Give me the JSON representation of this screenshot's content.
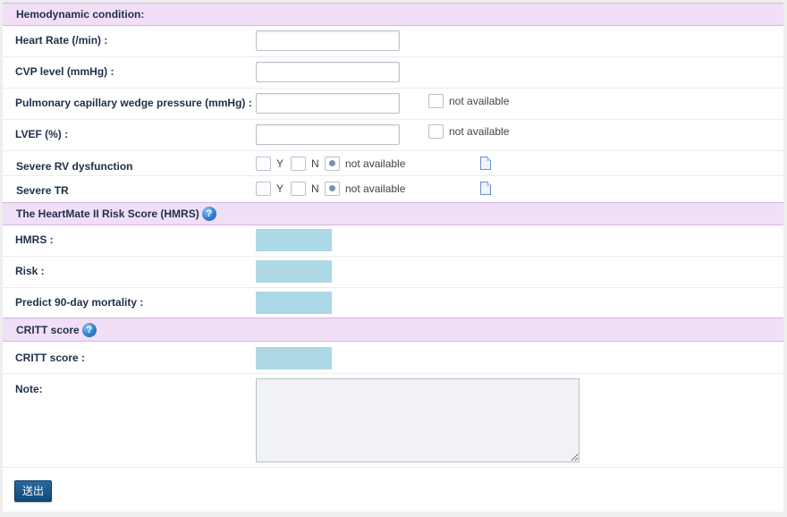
{
  "sections": {
    "hemodynamic": "Hemodynamic condition:",
    "hmrs": "The HeartMate II Risk Score (HMRS)",
    "critt": "CRITT score"
  },
  "help_glyph": "?",
  "fields": {
    "heart_rate": {
      "label": "Heart Rate (/min) :",
      "value": ""
    },
    "cvp": {
      "label": "CVP level (mmHg) :",
      "value": ""
    },
    "pcwp": {
      "label": "Pulmonary capillary wedge pressure (mmHg) :",
      "value": "",
      "na_label": "not available",
      "na_checked": false
    },
    "lvef": {
      "label": "LVEF (%) :",
      "value": "",
      "na_label": "not available",
      "na_checked": false
    }
  },
  "options": {
    "yes": "Y",
    "no": "N",
    "na": "not available"
  },
  "severe_rv": {
    "label": "Severe RV dysfunction",
    "selected": "not available"
  },
  "severe_tr": {
    "label": "Severe TR",
    "selected": "not available"
  },
  "results": {
    "hmrs": {
      "label": "HMRS :",
      "value": ""
    },
    "risk": {
      "label": "Risk :",
      "value": ""
    },
    "mortality": {
      "label": "Predict 90-day mortality :",
      "value": ""
    },
    "critt": {
      "label": "CRITT score :",
      "value": ""
    }
  },
  "note": {
    "label": "Note:",
    "value": ""
  },
  "submit_label": "送出",
  "colors": {
    "section_bg": "#f1def7",
    "result_bg": "#add8e6",
    "submit_bg": "#1a5a8c"
  },
  "icons": [
    "help-icon",
    "document-icon"
  ]
}
